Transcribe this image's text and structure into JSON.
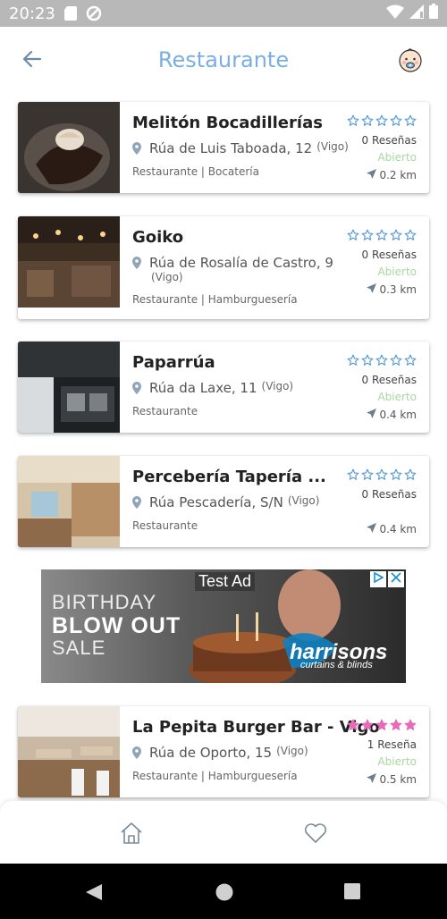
{
  "status_bar": {
    "time": "20:23",
    "left_icons": [
      "sd-card-icon",
      "data-saver-icon"
    ],
    "right_icons": [
      "wifi-icon",
      "signal-icon",
      "battery-icon"
    ]
  },
  "header": {
    "title": "Restaurante",
    "back_icon": "arrow-left-icon",
    "avatar_icon": "baby-face-icon",
    "title_color": "#7aaee3"
  },
  "restaurants": [
    {
      "name": "Melitón Bocadillerías",
      "street": "Rúa de Luis Taboada, 12",
      "city": "(Vigo)",
      "category": "Restaurante | Bocatería",
      "rating": 0,
      "reviews": "0 Reseñas",
      "status": "Abierto",
      "distance": "0.2 km"
    },
    {
      "name": "Goiko",
      "street": "Rúa de Rosalía de Castro, 9",
      "city": "(Vigo)",
      "category": "Restaurante | Hamburguesería",
      "rating": 0,
      "reviews": "0 Reseñas",
      "status": "Abierto",
      "distance": "0.3 km"
    },
    {
      "name": "Paparrúa",
      "street": "Rúa da Laxe, 11",
      "city": "(Vigo)",
      "category": "Restaurante",
      "rating": 0,
      "reviews": "0 Reseñas",
      "status": "Abierto",
      "distance": "0.4 km"
    },
    {
      "name": "Percebería Tapería ...",
      "street": "Rúa Pescadería, S/N",
      "city": "(Vigo)",
      "category": "Restaurante",
      "rating": 0,
      "reviews": "0 Reseñas",
      "status": "",
      "distance": "0.4 km"
    },
    {
      "name": "La Pepita Burger Bar - Vigo",
      "street": "Rúa de Oporto, 15",
      "city": "(Vigo)",
      "category": "Restaurante | Hamburguesería",
      "rating": 5,
      "reviews": "1 Reseña",
      "status": "Abierto",
      "distance": "0.5 km"
    }
  ],
  "ad": {
    "label": "Test Ad",
    "line1": "BIRTHDAY",
    "line2": "BLOW OUT",
    "line3": "SALE",
    "brand": "harrisons",
    "brand_sub": "curtains & blinds"
  },
  "tabs": [
    {
      "icon": "home-icon"
    },
    {
      "icon": "heart-icon"
    }
  ],
  "colors": {
    "star_empty": "#5b9bd5",
    "star_filled": "#e86bb8",
    "open_text": "#a8d8a0"
  },
  "nav": [
    "back-triangle-icon",
    "home-circle-icon",
    "recents-square-icon"
  ]
}
